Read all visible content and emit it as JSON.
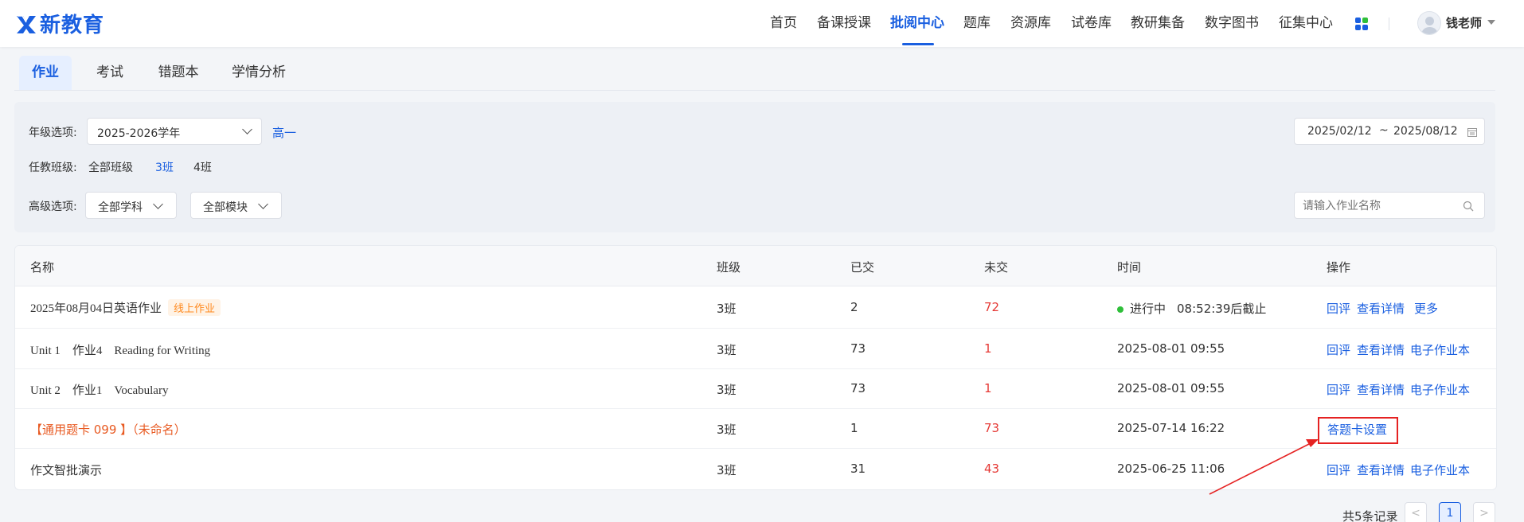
{
  "header": {
    "logo_text": "新教育",
    "nav": [
      "首页",
      "备课授课",
      "批阅中心",
      "题库",
      "资源库",
      "试卷库",
      "教研集备",
      "数字图书",
      "征集中心"
    ],
    "nav_active": "批阅中心",
    "user_name": "钱老师"
  },
  "subtabs": [
    "作业",
    "考试",
    "错题本",
    "学情分析"
  ],
  "filters": {
    "grade_label": "年级选项:",
    "year_value": "2025-2026学年",
    "grade_value": "高一",
    "class_label": "任教班级:",
    "classes": [
      "全部班级",
      "3班",
      "4班"
    ],
    "advanced_label": "高级选项:",
    "subject_value": "全部学科",
    "module_value": "全部模块",
    "date_start": "2025/02/12",
    "date_sep": "~",
    "date_end": "2025/08/12",
    "search_placeholder": "请输入作业名称"
  },
  "table": {
    "columns": [
      "名称",
      "班级",
      "已交",
      "未交",
      "时间",
      "操作"
    ],
    "rows": [
      {
        "name": "2025年08月04日英语作业",
        "tag": "线上作业",
        "class": "3班",
        "submitted": "2",
        "unsubmitted": "72",
        "status": "进行中",
        "time": "08:52:39后截止",
        "ops": [
          "回评",
          "查看详情",
          "更多"
        ]
      },
      {
        "name": "Unit 1　作业4　Reading for Writing",
        "class": "3班",
        "submitted": "73",
        "unsubmitted": "1",
        "time": "2025-08-01 09:55",
        "ops": [
          "回评",
          "查看详情",
          "电子作业本"
        ]
      },
      {
        "name": "Unit 2　作业1　Vocabulary",
        "class": "3班",
        "submitted": "73",
        "unsubmitted": "1",
        "time": "2025-08-01 09:55",
        "ops": [
          "回评",
          "查看详情",
          "电子作业本"
        ]
      },
      {
        "name": "【通用题卡 099 】（未命名）",
        "class": "3班",
        "submitted": "1",
        "unsubmitted": "73",
        "time": "2025-07-14 16:22",
        "ops": [
          "答题卡设置"
        ]
      },
      {
        "name": "作文智批演示",
        "class": "3班",
        "submitted": "31",
        "unsubmitted": "43",
        "time": "2025-06-25 11:06",
        "ops": [
          "回评",
          "查看详情",
          "电子作业本"
        ]
      }
    ]
  },
  "pagination": {
    "total_text": "共5条记录",
    "prev": "<",
    "current": "1",
    "next": ">"
  },
  "colors": {
    "brand": "#1a5fe0",
    "danger": "#e53935",
    "highlight": "#e52222"
  }
}
